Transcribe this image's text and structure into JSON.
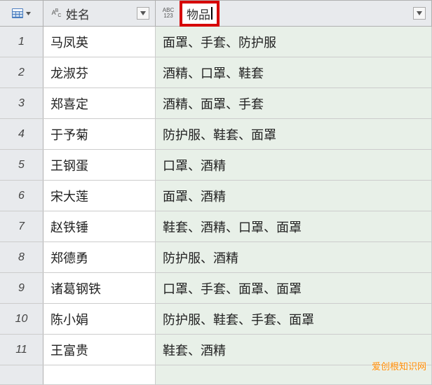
{
  "headers": {
    "nameTypeTop": "A",
    "nameTypeBot": "B C",
    "nameSuper": "B",
    "nameLabel": "姓名",
    "itemsTypeTop": "ABC",
    "itemsTypeBot": "123",
    "itemsLabel": "物品"
  },
  "rows": [
    {
      "idx": "1",
      "name": "马凤英",
      "items": "面罩、手套、防护服"
    },
    {
      "idx": "2",
      "name": "龙淑芬",
      "items": "酒精、口罩、鞋套"
    },
    {
      "idx": "3",
      "name": "郑喜定",
      "items": "酒精、面罩、手套"
    },
    {
      "idx": "4",
      "name": "于予菊",
      "items": "防护服、鞋套、面罩"
    },
    {
      "idx": "5",
      "name": "王钢蛋",
      "items": "口罩、酒精"
    },
    {
      "idx": "6",
      "name": "宋大莲",
      "items": "面罩、酒精"
    },
    {
      "idx": "7",
      "name": "赵铁锤",
      "items": "鞋套、酒精、口罩、面罩"
    },
    {
      "idx": "8",
      "name": "郑德勇",
      "items": "防护服、酒精"
    },
    {
      "idx": "9",
      "name": "诸葛钢铁",
      "items": "口罩、手套、面罩、面罩"
    },
    {
      "idx": "10",
      "name": "陈小娟",
      "items": "防护服、鞋套、手套、面罩"
    },
    {
      "idx": "11",
      "name": "王富贵",
      "items": "鞋套、酒精"
    }
  ],
  "partialRow": {
    "name": "",
    "items": ""
  },
  "watermark": "爱创根知识网"
}
